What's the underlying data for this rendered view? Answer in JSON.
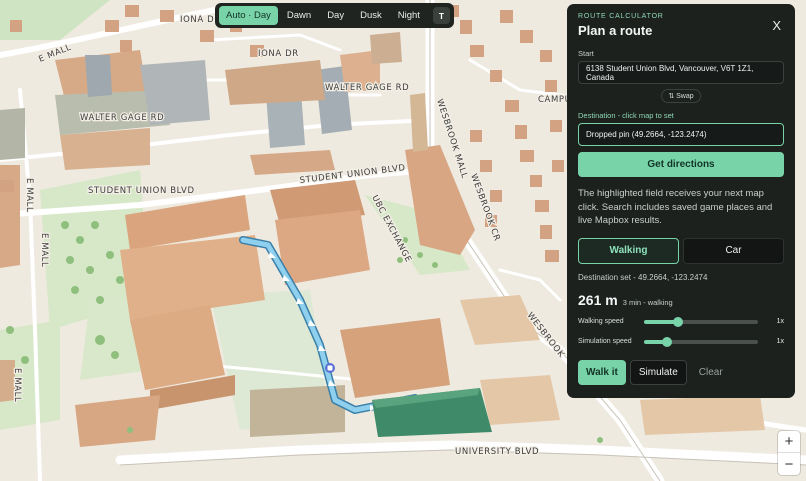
{
  "map": {
    "streets": {
      "e_mall_top": "E MALL",
      "iona_dr_1": "IONA DR",
      "iona_dr_2": "IONA DR",
      "walter_gage_rd_1": "WALTER GAGE RD",
      "walter_gage_rd_2": "WALTER GAGE RD",
      "student_union_blvd_1": "STUDENT UNION BLVD",
      "student_union_blvd_2": "STUDENT UNION BLVD",
      "e_mall_left_1": "E MALL",
      "e_mall_left_2": "E MALL",
      "e_mall_bottom": "E MALL",
      "wesbrook_mall": "WESBROOK MALL",
      "wesbrook_cr": "WESBROOK CR",
      "wesbrook_right": "WESBROOK",
      "ubc_exchange": "UBC EXCHANGE",
      "university_blvd": "UNIVERSITY BLVD",
      "campus": "CAMPU"
    },
    "route_color": "#8fd0ef",
    "destination_building_color": "#3f8a68"
  },
  "time_of_day": {
    "options": [
      "Auto · Day",
      "Dawn",
      "Day",
      "Dusk",
      "Night"
    ],
    "active_index": 0,
    "toggle_label": "T"
  },
  "panel": {
    "eyebrow": "ROUTE CALCULATOR",
    "title": "Plan a route",
    "close_label": "X",
    "start_label": "Start",
    "start_value": "6138 Student Union Blvd, Vancouver, V6T 1Z1, Canada",
    "swap_label": "⇅ Swap",
    "destination_label": "Destination - click map to set",
    "destination_value": "Dropped pin (49.2664, -123.2474)",
    "directions_button": "Get directions",
    "help_text": "The highlighted field receives your next map click. Search includes saved game places and live Mapbox results.",
    "modes": [
      "Walking",
      "Car"
    ],
    "active_mode": "Walking",
    "destination_note": "Destination set - 49.2664, -123.2474",
    "distance": "261 m",
    "eta": "3 min - walking",
    "walking_speed": {
      "label": "Walking speed",
      "value_label": "1x",
      "fraction": 0.3
    },
    "simulation_speed": {
      "label": "Simulation speed",
      "value_label": "1x",
      "fraction": 0.2
    },
    "walk_button": "Walk it",
    "simulate_button": "Simulate",
    "clear_button": "Clear",
    "accent_color": "#79d3a9"
  },
  "zoom": {
    "in_label": "+",
    "out_label": "−"
  }
}
